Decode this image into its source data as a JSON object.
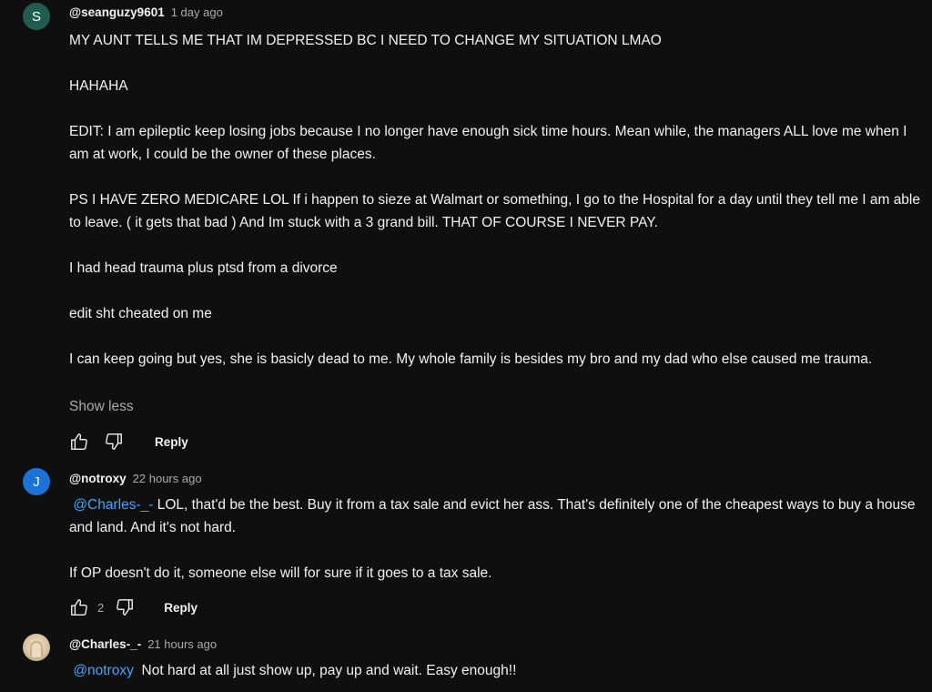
{
  "comments": [
    {
      "avatar_letter": "S",
      "avatar_color": "#1f5e4e",
      "author": "@seanguzy9601",
      "time": "1 day ago",
      "paragraphs": [
        "MY AUNT TELLS ME THAT IM DEPRESSED BC I NEED TO CHANGE MY SITUATION LMAO",
        "HAHAHA",
        "EDIT: I am epileptic keep losing jobs because I no longer have enough sick time hours. Mean while, the managers ALL love me when I am at work, I could be the owner of these places.",
        "PS I HAVE ZERO MEDICARE LOL If i happen to sieze at Walmart or something, I go to the Hospital for  a day until they tell me I am able to leave. ( it gets that bad ) And Im stuck with a 3 grand bill. THAT OF COURSE I NEVER PAY.",
        "I had head trauma plus ptsd from a divorce",
        "edit  sht cheated on me",
        "I can  keep going but yes, she is basicly dead to me. My whole family is besides my bro and my dad who else caused me trauma."
      ],
      "show_less": "Show less",
      "like_count": "",
      "reply_label": "Reply"
    },
    {
      "avatar_letter": "J",
      "avatar_color": "#1a73d9",
      "author": "@notroxy",
      "time": "22 hours ago",
      "mention": "@Charles-_-",
      "paragraph1_rest": " LOL, that'd be the best. Buy it from a tax sale and evict her ass. That's definitely one of the cheapest ways to buy a house and land. And it's not hard.",
      "paragraph2": "If OP doesn't do it, someone else will for sure if it goes to a tax sale.",
      "like_count": "2",
      "reply_label": "Reply"
    },
    {
      "author": "@Charles-_-",
      "time": "21 hours ago",
      "mention": "@notroxy",
      "text_rest": "Not hard at all just show up, pay up and wait. Easy enough!!"
    }
  ],
  "icons": {
    "like": "thumbs-up-icon",
    "dislike": "thumbs-down-icon"
  },
  "colors": {
    "background": "#0f0f0f",
    "mention": "#3ea6ff",
    "secondary_text": "#aaaaaa"
  }
}
